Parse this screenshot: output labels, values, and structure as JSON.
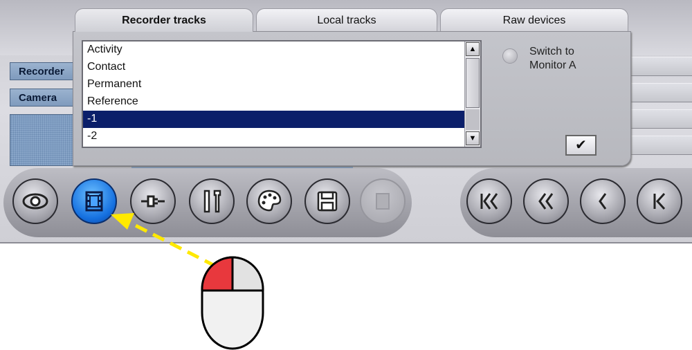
{
  "tabs": [
    {
      "label": "Recorder tracks",
      "active": true
    },
    {
      "label": "Local tracks",
      "active": false
    },
    {
      "label": "Raw devices",
      "active": false
    }
  ],
  "side_tabs": [
    "Recorder",
    "Camera"
  ],
  "track_list": {
    "items": [
      "Activity",
      "Contact",
      "Permanent",
      "Reference",
      "-1",
      "-2"
    ],
    "selected": "-1"
  },
  "radio": {
    "label": "Switch to Monitor A",
    "checked": false
  },
  "confirm_button": {
    "icon": "checkmark-icon",
    "glyph": "✔"
  },
  "toolbar": {
    "buttons": [
      {
        "icon": "eye-icon"
      },
      {
        "icon": "film-icon",
        "active": true
      },
      {
        "icon": "plug-icon"
      },
      {
        "icon": "tools-icon"
      },
      {
        "icon": "palette-icon"
      },
      {
        "icon": "floppy-disk-icon"
      },
      {
        "icon": "disabled-button-icon"
      }
    ],
    "playback": [
      "skip-to-start-icon",
      "rewind-icon",
      "step-back-icon",
      "frame-back-icon"
    ]
  },
  "colors": {
    "selection": "#0b1f6a",
    "active_button": "#1570e0",
    "arrow": "#ffe900",
    "mouse_left_button": "#e8383d"
  }
}
